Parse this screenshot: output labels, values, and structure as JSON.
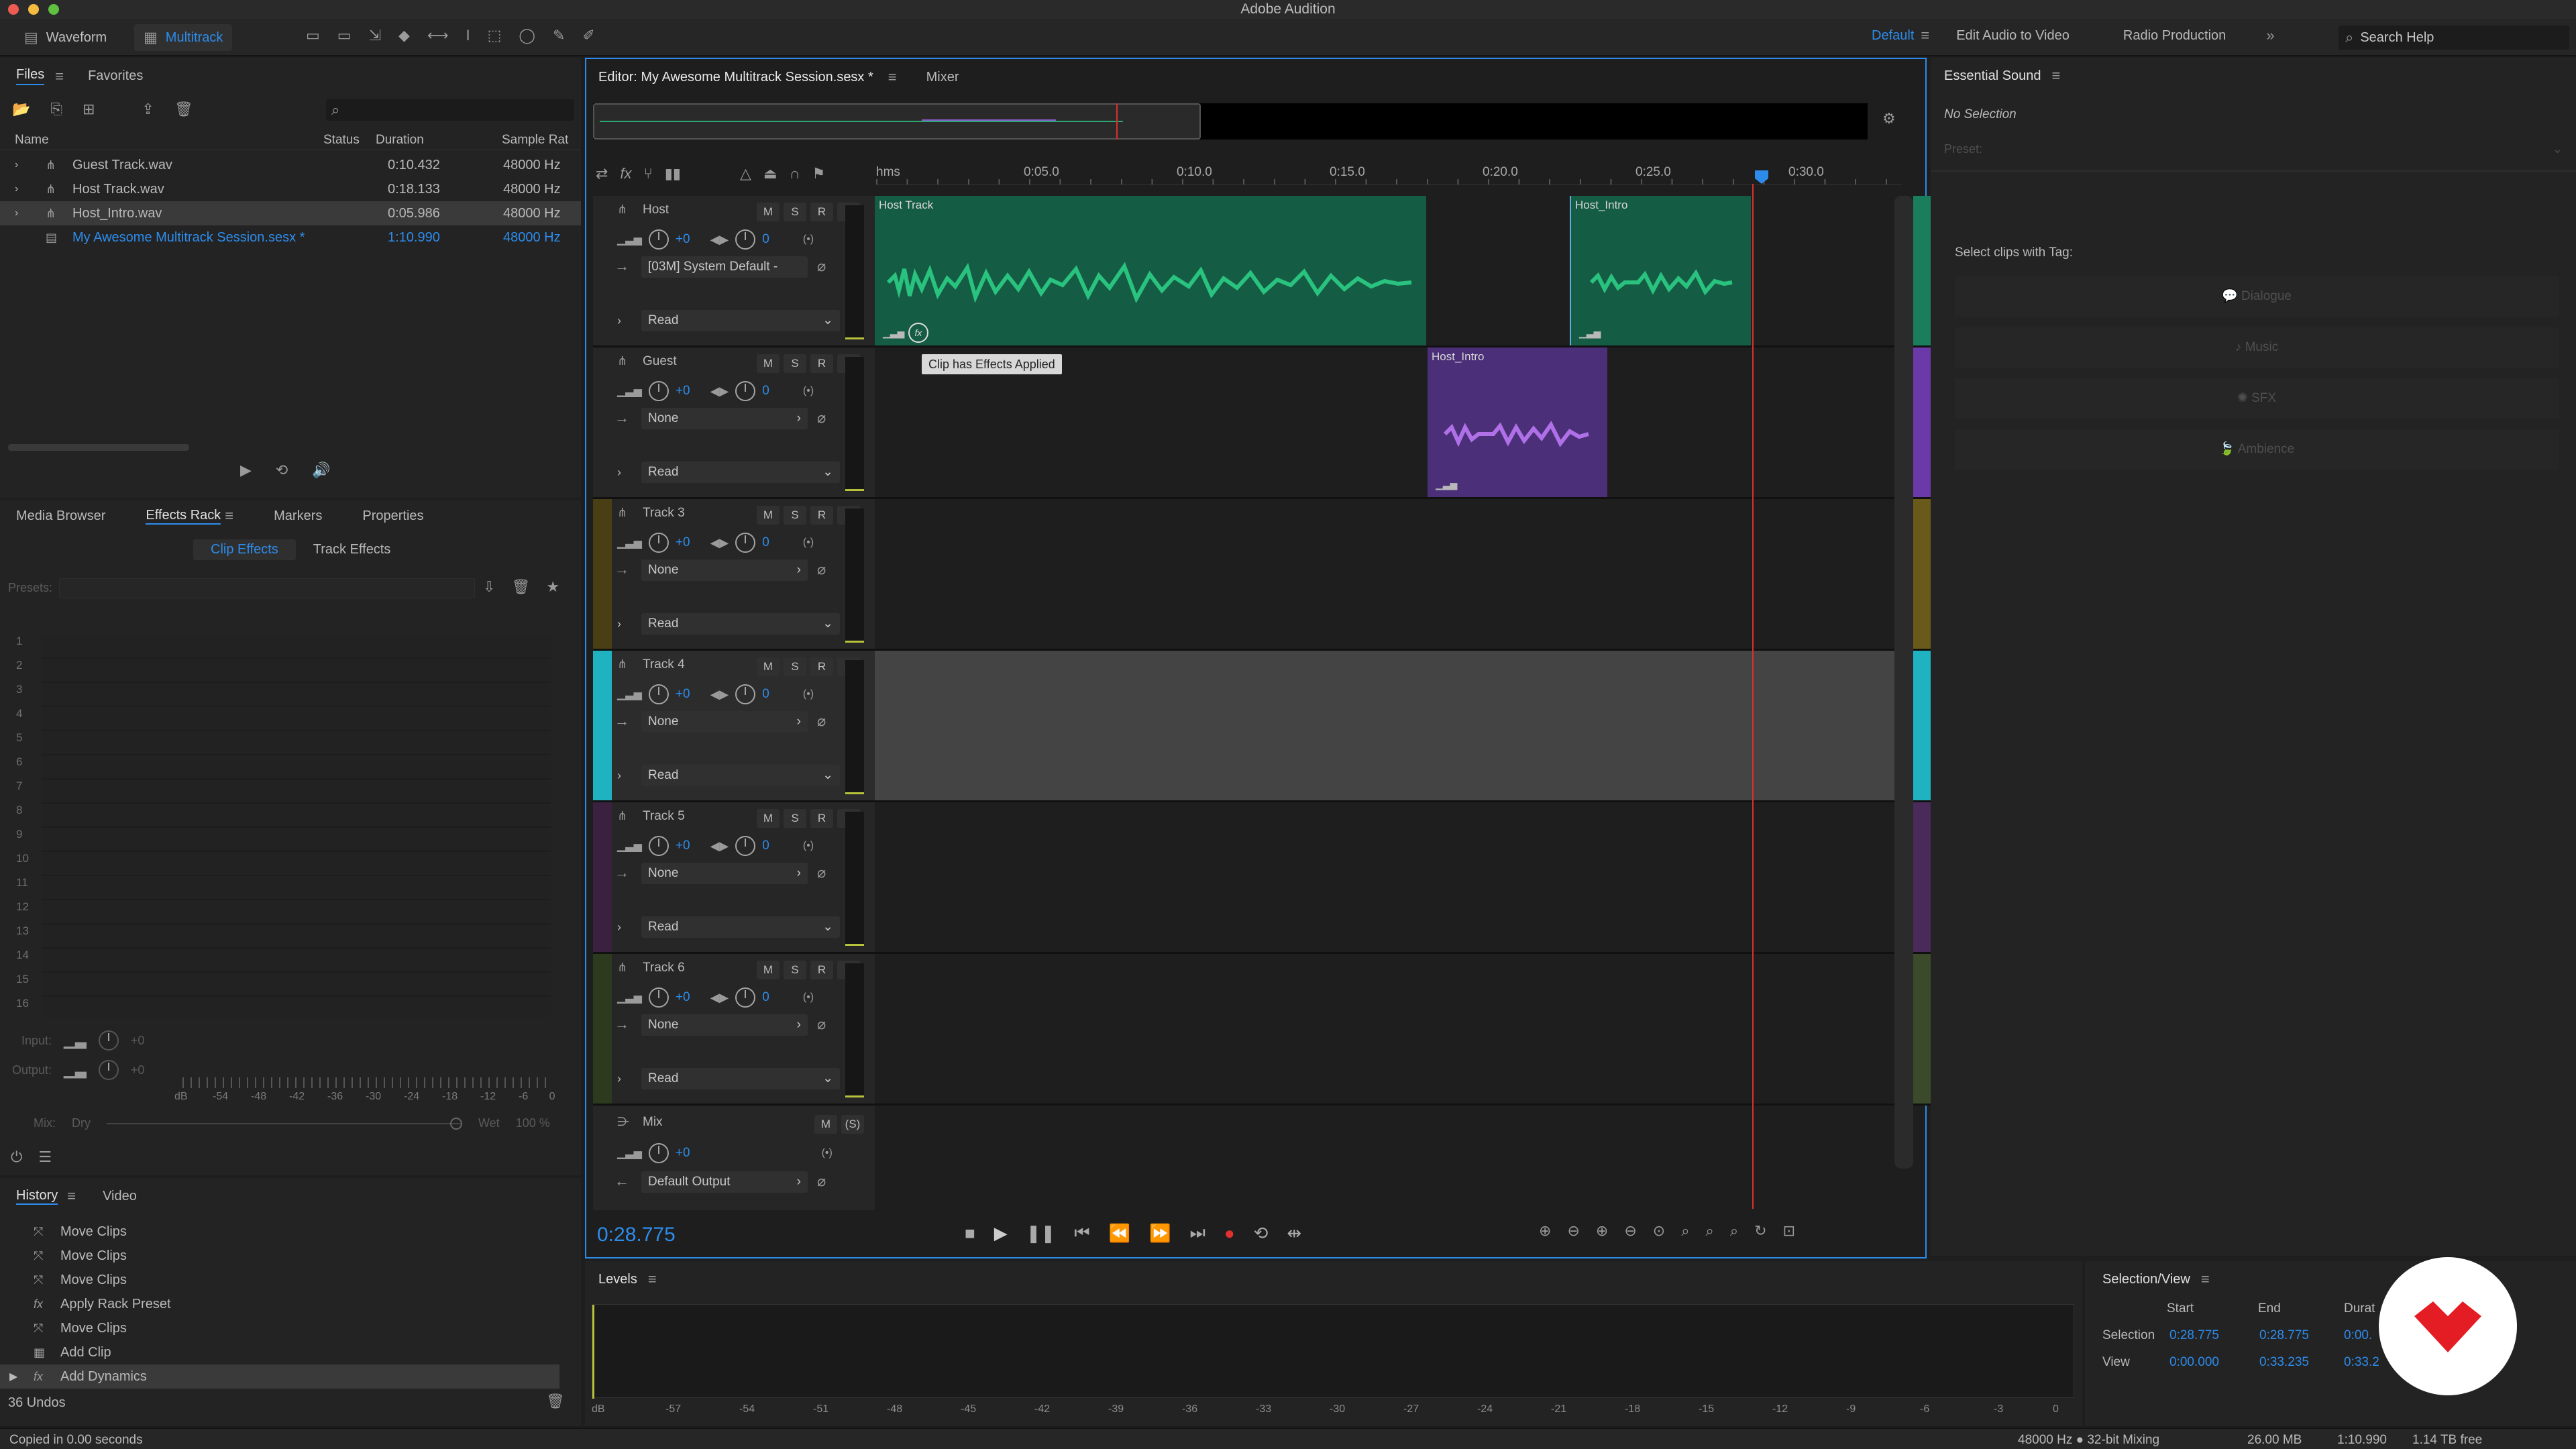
{
  "app_title": "Adobe Audition",
  "toolbar": {
    "waveform": "Waveform",
    "multitrack": "Multitrack",
    "workspaces": [
      "Default",
      "Edit Audio to Video",
      "Radio Production"
    ],
    "search_placeholder": "Search Help"
  },
  "files_panel": {
    "tabs": [
      "Files",
      "Favorites"
    ],
    "columns": [
      "Name",
      "Status",
      "Duration",
      "Sample Rat"
    ],
    "rows": [
      {
        "name": "Guest Track.wav",
        "duration": "0:10.432",
        "rate": "48000 Hz"
      },
      {
        "name": "Host Track.wav",
        "duration": "0:18.133",
        "rate": "48000 Hz"
      },
      {
        "name": "Host_Intro.wav",
        "duration": "0:05.986",
        "rate": "48000 Hz"
      },
      {
        "name": "My Awesome Multitrack Session.sesx *",
        "duration": "1:10.990",
        "rate": "48000 Hz"
      }
    ]
  },
  "effects_panel": {
    "tabs": [
      "Media Browser",
      "Effects Rack",
      "Markers",
      "Properties"
    ],
    "subtabs": [
      "Clip Effects",
      "Track Effects"
    ],
    "presets_label": "Presets:",
    "slots": [
      "1",
      "2",
      "3",
      "4",
      "5",
      "6",
      "7",
      "8",
      "9",
      "10",
      "11",
      "12",
      "13",
      "14",
      "15",
      "16"
    ],
    "input_label": "Input:",
    "output_label": "Output:",
    "input_value": "+0",
    "output_value": "+0",
    "db_scale": [
      "dB",
      "-54",
      "-48",
      "-42",
      "-36",
      "-30",
      "-24",
      "-18",
      "-12",
      "-6",
      "0"
    ],
    "mix_label": "Mix:",
    "dry": "Dry",
    "wet": "Wet",
    "wet_pct": "100 %"
  },
  "history_panel": {
    "tabs": [
      "History",
      "Video"
    ],
    "items": [
      "Move Clips",
      "Move Clips",
      "Move Clips",
      "Apply Rack Preset",
      "Move Clips",
      "Add Clip",
      "Add Dynamics"
    ],
    "undos": "36 Undos"
  },
  "editor": {
    "tab": "Editor: My Awesome Multitrack Session.sesx *",
    "mixer_tab": "Mixer",
    "ruler": [
      "hms",
      "0:05.0",
      "0:10.0",
      "0:15.0",
      "0:20.0",
      "0:25.0",
      "0:30.0"
    ],
    "tooltip": "Clip has Effects Applied",
    "time": "0:28.775",
    "tracks": [
      {
        "name": "Host",
        "vol": "+0",
        "pan": "0",
        "input": "[03M] System Default -",
        "mode": "Read",
        "color": "#1a7e5c"
      },
      {
        "name": "Guest",
        "vol": "+0",
        "pan": "0",
        "input": "None",
        "mode": "Read",
        "color": "#6b3aa8"
      },
      {
        "name": "Track 3",
        "vol": "+0",
        "pan": "0",
        "input": "None",
        "mode": "Read",
        "color": "#6a5a1a"
      },
      {
        "name": "Track 4",
        "vol": "+0",
        "pan": "0",
        "input": "None",
        "mode": "Read",
        "color": "#1fb3c2"
      },
      {
        "name": "Track 5",
        "vol": "+0",
        "pan": "0",
        "input": "None",
        "mode": "Read",
        "color": "#4a2a5a"
      },
      {
        "name": "Track 6",
        "vol": "+0",
        "pan": "0",
        "input": "None",
        "mode": "Read",
        "color": "#3a4a2a"
      }
    ],
    "mix": {
      "name": "Mix",
      "vol": "+0",
      "output": "Default Output"
    },
    "clips": {
      "host": "Host Track",
      "host_intro_1": "Host_Intro",
      "host_intro_2": "Host_Intro"
    }
  },
  "essential_sound": {
    "title": "Essential Sound",
    "no_selection": "No Selection",
    "preset": "Preset:",
    "tag_label": "Select clips with Tag:",
    "tags": [
      "Dialogue",
      "Music",
      "SFX",
      "Ambience"
    ]
  },
  "levels": {
    "title": "Levels",
    "scale": [
      "dB",
      "-57",
      "-54",
      "-51",
      "-48",
      "-45",
      "-42",
      "-39",
      "-36",
      "-33",
      "-30",
      "-27",
      "-24",
      "-21",
      "-18",
      "-15",
      "-12",
      "-9",
      "-6",
      "-3",
      "0"
    ]
  },
  "selection_view": {
    "title": "Selection/View",
    "cols": [
      "Start",
      "End",
      "Durat"
    ],
    "selection_label": "Selection",
    "view_label": "View",
    "sel_start": "0:28.775",
    "sel_end": "0:28.775",
    "sel_dur": "0:00.",
    "view_start": "0:00.000",
    "view_end": "0:33.235",
    "view_dur": "0:33.2"
  },
  "status_bar": {
    "left": "Copied in 0.00 seconds",
    "mixing": "48000 Hz ● 32-bit Mixing",
    "mem": "26.00 MB",
    "dur": "1:10.990",
    "free": "1.14 TB free"
  },
  "colors": {
    "accent": "#2d8ceb",
    "playhead": "#d93030",
    "host_wave": "#29c27e",
    "guest_wave": "#b070e8"
  }
}
